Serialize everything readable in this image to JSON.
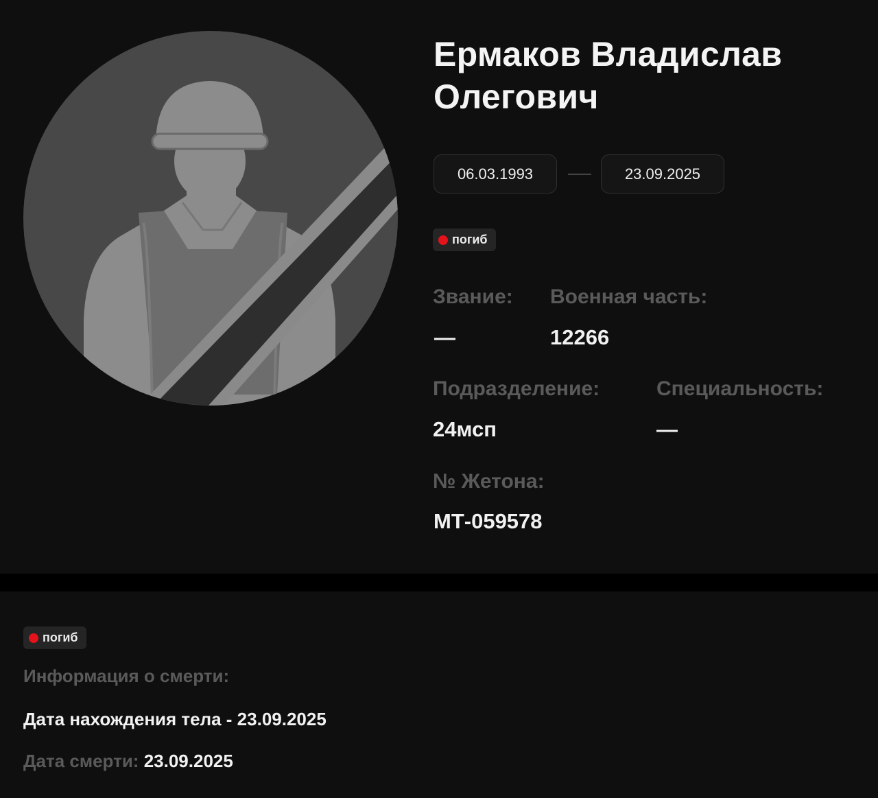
{
  "person": {
    "name": "Ермаков Владислав Олегович",
    "birth_date": "06.03.1993",
    "death_date": "23.09.2025",
    "status": "погиб"
  },
  "fields": {
    "rank_label": "Звание:",
    "rank_value": "—",
    "unit_label": "Военная часть:",
    "unit_value": "12266",
    "division_label": "Подразделение:",
    "division_value": "24мсп",
    "specialty_label": "Специальность:",
    "specialty_value": "—",
    "token_label": "№ Жетона:",
    "token_value": "МТ-059578"
  },
  "death_info": {
    "status": "погиб",
    "title": "Информация о смерти:",
    "body_found": "Дата нахождения тела - 23.09.2025",
    "death_date_label": "Дата смерти:",
    "death_date_value": "23.09.2025"
  },
  "colors": {
    "status_dot": "#e3121b",
    "label": "#5a5a5a",
    "value": "#f2f2f2",
    "card_bg": "#0f0f0f"
  },
  "icons": {
    "avatar": "soldier-silhouette-icon",
    "mourning_ribbon": "mourning-ribbon-icon"
  }
}
